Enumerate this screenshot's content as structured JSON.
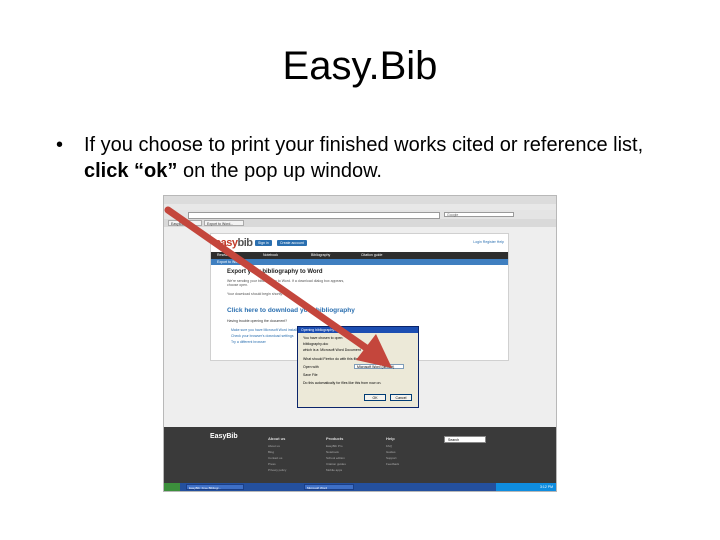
{
  "slide": {
    "title": "Easy.Bib",
    "bullet_symbol": "•",
    "bullet_part1": "If you choose to print your finished works cited or reference list, ",
    "bullet_bold": "click “ok”",
    "bullet_part2": " on the pop up window."
  },
  "browser": {
    "search_placeholder": "Google",
    "tabs": [
      "EasyBib",
      "Export to Word..."
    ]
  },
  "site": {
    "logo_easy": "easy",
    "logo_bib": "bib",
    "header_buttons": [
      "Sign in",
      "Create account"
    ],
    "top_links": "Login  Register  Help",
    "nav_items": [
      "Research",
      "Notebook",
      "Bibliography",
      "Citation guide"
    ],
    "subnav": "Export to Word",
    "export_title": "Export your bibliography to Word",
    "paragraphs": [
      "We're sending your bibliography to Word. If a download dialog box appears, choose open.",
      "Your download should begin shortly."
    ],
    "download_link": "Click here to download your bibliography",
    "subheading": "Having trouble opening the document?",
    "list_items": [
      "Make sure you have Microsoft Word installed",
      "Check your browser's download settings",
      "Try a different browser"
    ]
  },
  "dialog": {
    "title": "Opening bibliography.doc",
    "lines": [
      "You have chosen to open:",
      "bibliography.doc",
      "which is a: Microsoft Word Document",
      "What should Firefox do with this file?"
    ],
    "options": [
      "Open with",
      "Save File"
    ],
    "select_value": "Microsoft Word (default)",
    "checkbox": "Do this automatically for files like this from now on.",
    "ok_label": "OK",
    "cancel_label": "Cancel"
  },
  "footer": {
    "logo": "EasyBib",
    "columns": [
      {
        "head": "About us",
        "links": [
          "About us",
          "Blog",
          "Contact us",
          "Press",
          "Privacy policy"
        ]
      },
      {
        "head": "Products",
        "links": [
          "EasyBib Pro",
          "Notebook",
          "School edition",
          "Citation guides",
          "Mobile apps"
        ]
      },
      {
        "head": "Help",
        "links": [
          "FAQ",
          "Guides",
          "Support",
          "Feedback"
        ]
      }
    ],
    "search_text": "Search"
  },
  "taskbar": {
    "tasks": [
      "EasyBib: Free Bibliogr...",
      "Microsoft Word"
    ],
    "clock": "3:12 PM"
  },
  "colors": {
    "arrow": "#c4463c",
    "brand_blue": "#2a6fb0",
    "logo_red": "#c23b2a"
  }
}
